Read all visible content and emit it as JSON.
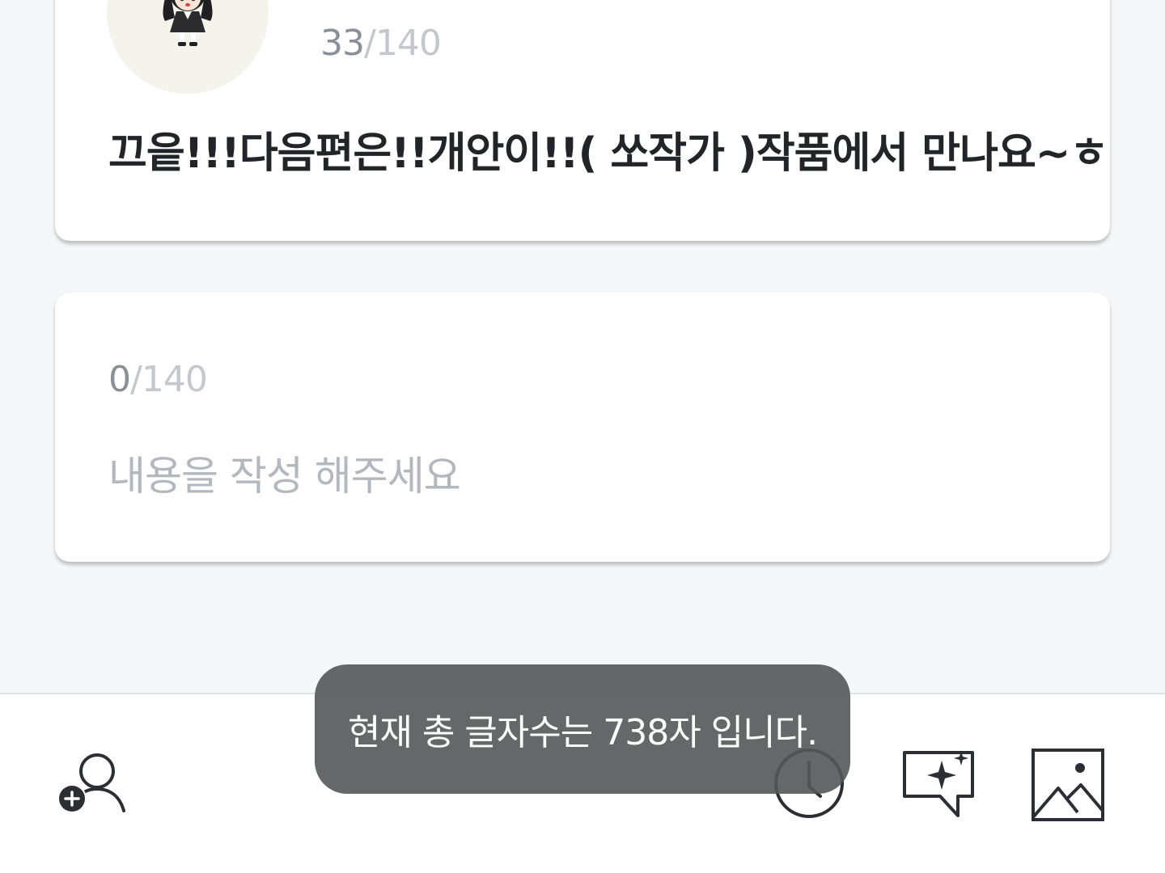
{
  "posts": [
    {
      "char_count": "33",
      "separator": "/",
      "char_max": "140",
      "text": "끄읕!!!다음편은!!개안이!!( 쏘작가 )작품에서 만나요~ㅎ"
    }
  ],
  "composer": {
    "char_count": "0",
    "separator": "/",
    "char_max": "140",
    "placeholder": "내용을 작성 해주세요"
  },
  "toast": {
    "message": "현재 총 글자수는 738자 입니다."
  },
  "toolbar": {
    "icons": [
      "add-character-icon",
      "history-clock-icon",
      "ai-sparkle-chat-icon",
      "image-icon"
    ]
  },
  "colors": {
    "background": "#f6f7f9",
    "card": "#ffffff",
    "text_primary": "#222428",
    "counter_current": "#8a9099",
    "counter_max": "#c4c8ce",
    "placeholder": "#b3b8bf",
    "toast_bg": "#545658",
    "icon": "#2b2e33"
  }
}
